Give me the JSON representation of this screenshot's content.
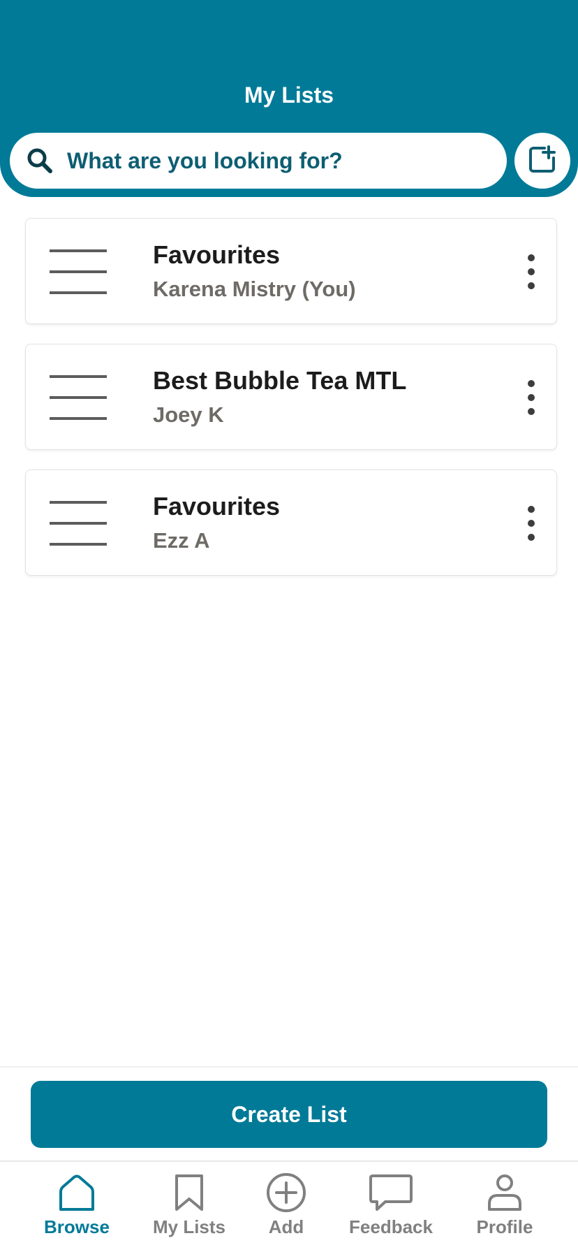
{
  "header": {
    "title": "My Lists",
    "search_placeholder": "What are you looking for?"
  },
  "lists": [
    {
      "title": "Favourites",
      "owner": "Karena Mistry (You)"
    },
    {
      "title": "Best Bubble Tea MTL",
      "owner": "Joey K"
    },
    {
      "title": "Favourites",
      "owner": "Ezz A"
    }
  ],
  "create_button_label": "Create List",
  "nav": [
    {
      "label": "Browse",
      "icon": "home-icon",
      "active": true
    },
    {
      "label": "My Lists",
      "icon": "bookmark-icon",
      "active": false
    },
    {
      "label": "Add",
      "icon": "plus-circle-icon",
      "active": false
    },
    {
      "label": "Feedback",
      "icon": "chat-bubble-icon",
      "active": false
    },
    {
      "label": "Profile",
      "icon": "person-icon",
      "active": false
    }
  ],
  "colors": {
    "brand": "#017a98",
    "nav_inactive": "#808080",
    "owner_text": "#6e6b66"
  }
}
